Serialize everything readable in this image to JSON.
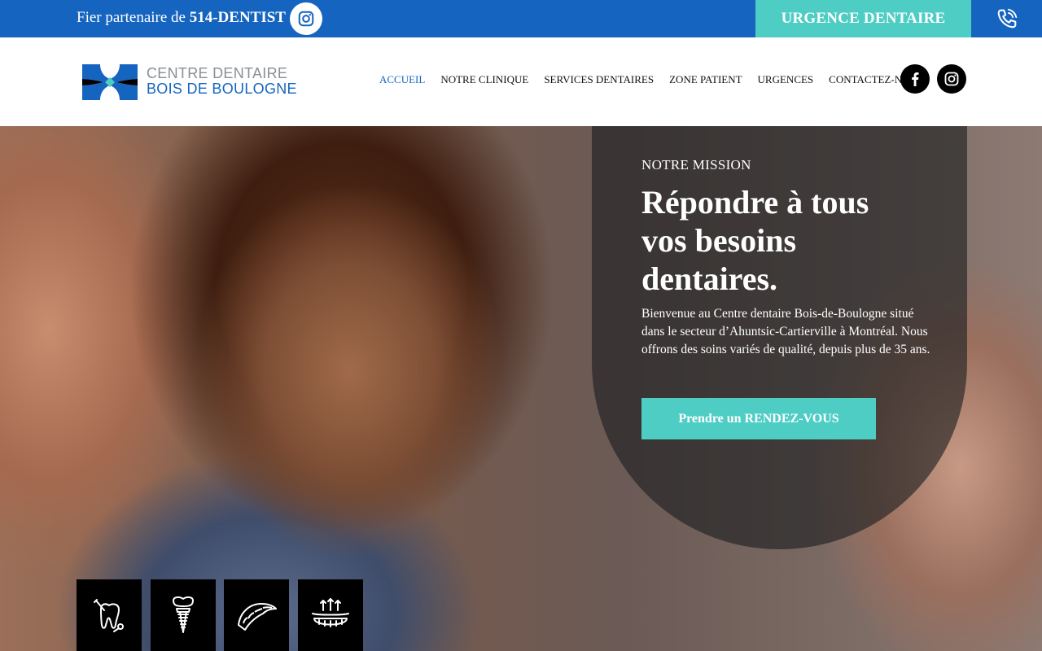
{
  "topbar": {
    "partner_prefix": "Fier partenaire de ",
    "partner_brand": "514-DENTIST",
    "urgence_label": "URGENCE DENTAIRE"
  },
  "logo": {
    "line1": "CENTRE DENTAIRE",
    "line2": "BOIS DE BOULOGNE"
  },
  "nav": {
    "items": [
      {
        "label": "ACCUEIL"
      },
      {
        "label": "NOTRE CLINIQUE"
      },
      {
        "label": "SERVICES DENTAIRES"
      },
      {
        "label": "ZONE PATIENT"
      },
      {
        "label": "URGENCES"
      },
      {
        "label": "CONTACTEZ-NOUS"
      }
    ],
    "active_index": 0
  },
  "hero": {
    "eyebrow": "NOTRE MISSION",
    "headline": "Répondre à tous vos besoins dentaires.",
    "description": "Bienvenue au Centre dentaire Bois-de-Boulogne situé dans le secteur d’Ahuntsic-Cartierville à Montréal. Nous offrons des soins variés de qualité, depuis plus de 35 ans.",
    "cta_label": "Prendre un RENDEZ-VOUS"
  },
  "service_icons": [
    "tooth-tool-icon",
    "dental-implant-icon",
    "dental-aligner-icon",
    "denture-icon"
  ],
  "icons": {
    "instagram": "instagram-icon",
    "phone": "phone-icon",
    "facebook": "facebook-icon"
  },
  "colors": {
    "primary_blue": "#1565c0",
    "accent_teal": "#4ecdc4",
    "nav_text": "#111111",
    "logo_gray": "#8a8f96"
  }
}
